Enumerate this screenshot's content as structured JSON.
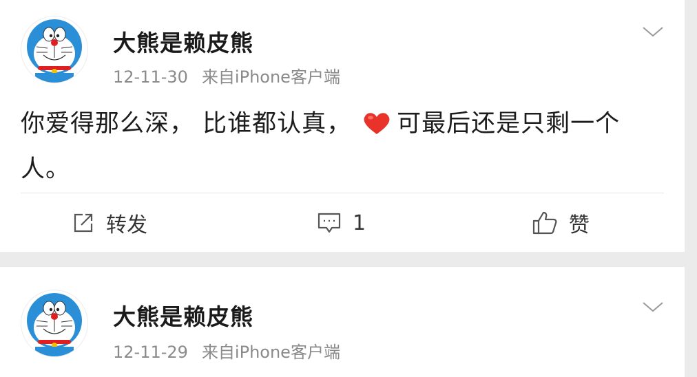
{
  "posts": [
    {
      "author": "大熊是赖皮熊",
      "date": "12-11-30",
      "source": "来自iPhone客户端",
      "content_before": "你爱得那么深，  比谁都认真，",
      "emoji": "red-heart",
      "content_after": "可最后还是只剩一个人。",
      "actions": {
        "repost": "转发",
        "comment": "1",
        "like": "赞"
      }
    },
    {
      "author": "大熊是赖皮熊",
      "date": "12-11-29",
      "source": "来自iPhone客户端"
    }
  ],
  "colors": {
    "heart": "#e8322a",
    "avatar_blue": "#2a8fd6",
    "nose": "#e02020"
  }
}
